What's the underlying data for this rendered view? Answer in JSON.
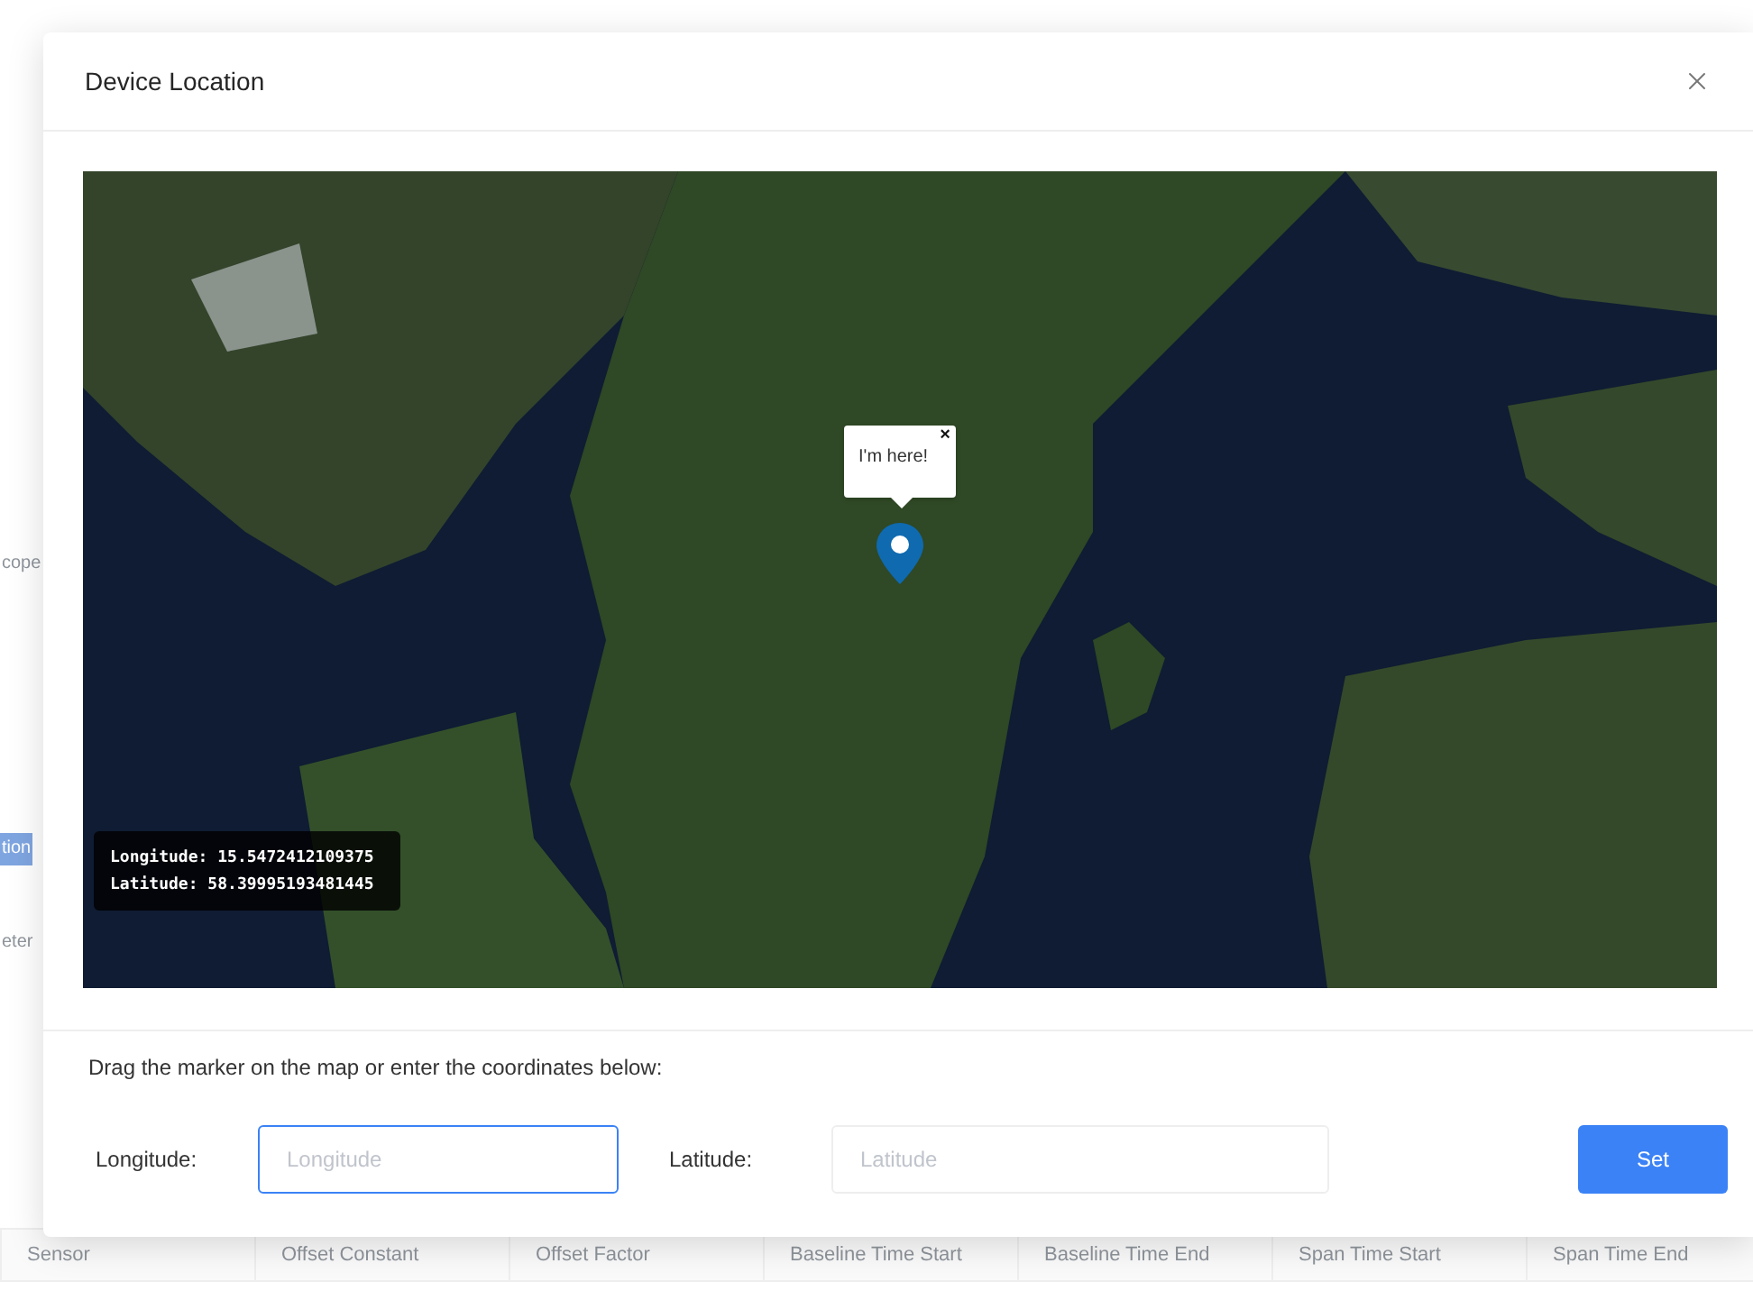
{
  "background_page": {
    "side_texts": [
      {
        "text": "cope",
        "selected": false
      },
      {
        "text": "tion",
        "selected": true
      },
      {
        "text": "eter",
        "selected": false
      }
    ],
    "table": {
      "columns": [
        "Sensor",
        "Offset Constant",
        "Offset Factor",
        "Baseline Time Start",
        "Baseline Time End",
        "Span Time Start",
        "Span Time End"
      ]
    }
  },
  "dialog": {
    "title": "Device Location",
    "map": {
      "popup": {
        "text": "I'm here!",
        "close": "×"
      },
      "coordinates": [
        "Longitude: 15.5472412109375",
        "Latitude: 58.39995193481445"
      ]
    },
    "instruction": "Drag the marker on the map or enter the coordinates below:",
    "fields": [
      {
        "label": "Longitude:",
        "placeholder": "Longitude",
        "focused": true
      },
      {
        "label": "Latitude:",
        "placeholder": "Latitude",
        "focused": false
      }
    ],
    "button": "Set"
  }
}
